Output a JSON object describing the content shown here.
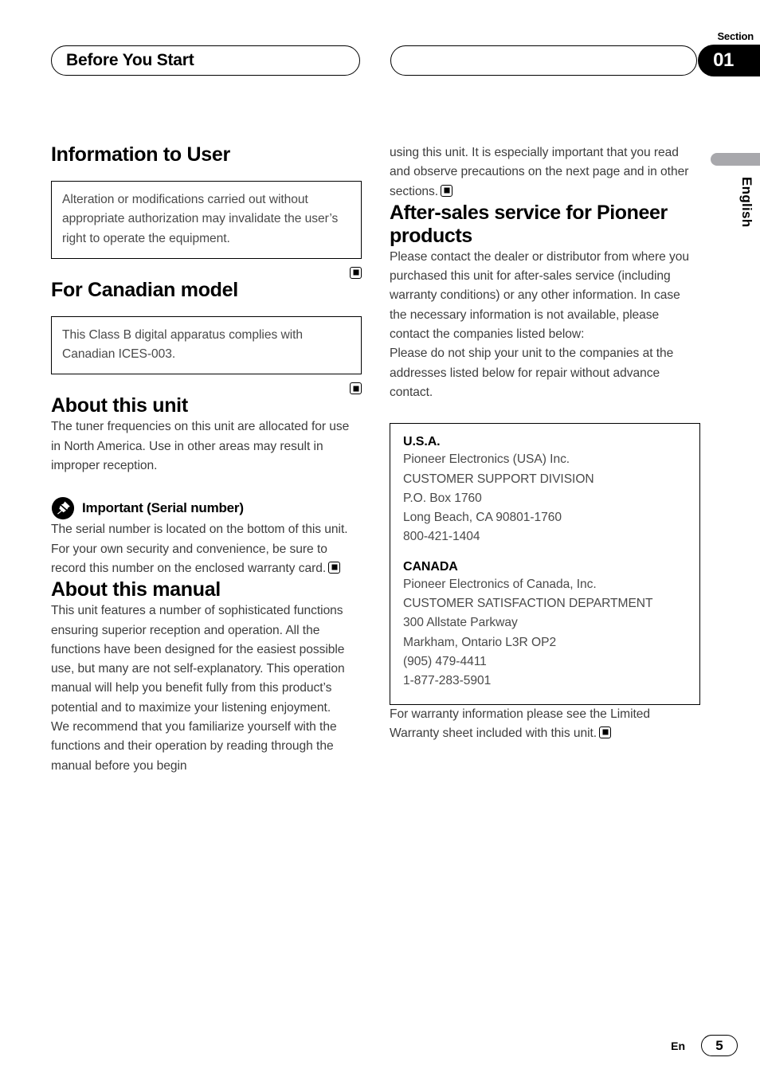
{
  "header": {
    "left_pill_title": "Before You Start",
    "right_pill_title": "",
    "section_label": "Section",
    "section_number": "01"
  },
  "side_tab": {
    "language": "English"
  },
  "left_column": {
    "information_to_user": {
      "heading": "Information to User",
      "notice": "Alteration or modifications carried out without appropriate authorization may invalidate the user’s right to operate the equipment.",
      "end_marker": "end-of-section-marker"
    },
    "for_canadian_model": {
      "heading": "For Canadian model",
      "notice": "This Class B digital apparatus complies with Canadian ICES-003.",
      "end_marker": "end-of-section-marker"
    },
    "about_this_unit": {
      "heading": "About this unit",
      "body": "The tuner frequencies on this unit are allocated for use in North America. Use in other areas may result in improper reception.",
      "important_heading": "Important (Serial number)",
      "important_body": "The serial number is located on the bottom of this unit. For your own security and convenience, be sure to record this number on the enclosed warranty card."
    },
    "about_this_manual": {
      "heading": "About this manual",
      "paragraph_1": "This unit features a number of sophisticated functions ensuring superior reception and operation. All the functions have been designed for the easiest possible use, but many are not self-explanatory. This operation manual will help you benefit fully from this product’s potential and to maximize your listening enjoyment.",
      "paragraph_2": "We recommend that you familiarize yourself with the functions and their operation by reading through the manual before you begin"
    }
  },
  "right_column": {
    "continuation": "using this unit. It is especially important that you read and observe precautions on the next page and in other sections.",
    "after_sales": {
      "heading": "After-sales service for Pioneer products",
      "paragraph_1": "Please contact the dealer or distributor from where you purchased this unit for after-sales service (including warranty conditions) or any other information. In case the necessary information is not available, please contact the companies listed below:",
      "paragraph_2": "Please do not ship your unit to the companies at the addresses listed below for repair without advance contact."
    },
    "addresses": [
      {
        "country": "U.S.A.",
        "lines": [
          "Pioneer Electronics (USA) Inc.",
          "CUSTOMER SUPPORT DIVISION",
          "P.O. Box 1760",
          "Long Beach, CA 90801-1760",
          "800-421-1404"
        ]
      },
      {
        "country": "CANADA",
        "lines": [
          "Pioneer Electronics of Canada, Inc.",
          "CUSTOMER SATISFACTION DEPARTMENT",
          "300 Allstate Parkway",
          "Markham, Ontario L3R OP2",
          "(905) 479-4411",
          "1-877-283-5901"
        ]
      }
    ],
    "warranty_note": "For warranty information please see the Limited Warranty sheet included with this unit."
  },
  "footer": {
    "language_code": "En",
    "page_number": "5"
  },
  "colors": {
    "ink": "#000000",
    "body_text": "#3d3d3d",
    "side_tab_gray": "#a8a8ac",
    "page_background": "#ffffff"
  }
}
